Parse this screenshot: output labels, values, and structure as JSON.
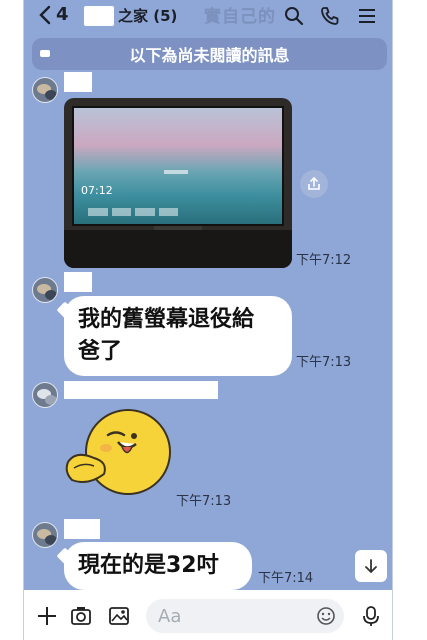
{
  "header": {
    "back_count": "4",
    "chat_title": "之家 (5)",
    "ghost_text": "實自己的"
  },
  "banner": {
    "text": "以下為尚未閱讀的訊息"
  },
  "messages": [
    {
      "type": "photo",
      "time": "下午7:12"
    },
    {
      "type": "text",
      "lines": [
        "我的舊螢幕退役給",
        "爸了"
      ],
      "time": "下午7:13"
    },
    {
      "type": "sticker",
      "time": "下午7:13"
    },
    {
      "type": "text",
      "lines": [
        "現在的是32吋"
      ],
      "time": "下午7:14"
    }
  ],
  "photo": {
    "clock": "07:12"
  },
  "input": {
    "placeholder": "Aa"
  },
  "colors": {
    "chat_bg": "#8fa7d6",
    "bubble": "#ffffff",
    "banner": "#7d92c3"
  },
  "icons": {
    "header": [
      "chevron-left-icon",
      "search-icon",
      "phone-icon",
      "menu-icon"
    ],
    "input": [
      "plus-icon",
      "camera-icon",
      "image-icon",
      "emoji-icon",
      "mic-icon"
    ],
    "other": [
      "share-icon",
      "arrow-down-icon"
    ]
  }
}
